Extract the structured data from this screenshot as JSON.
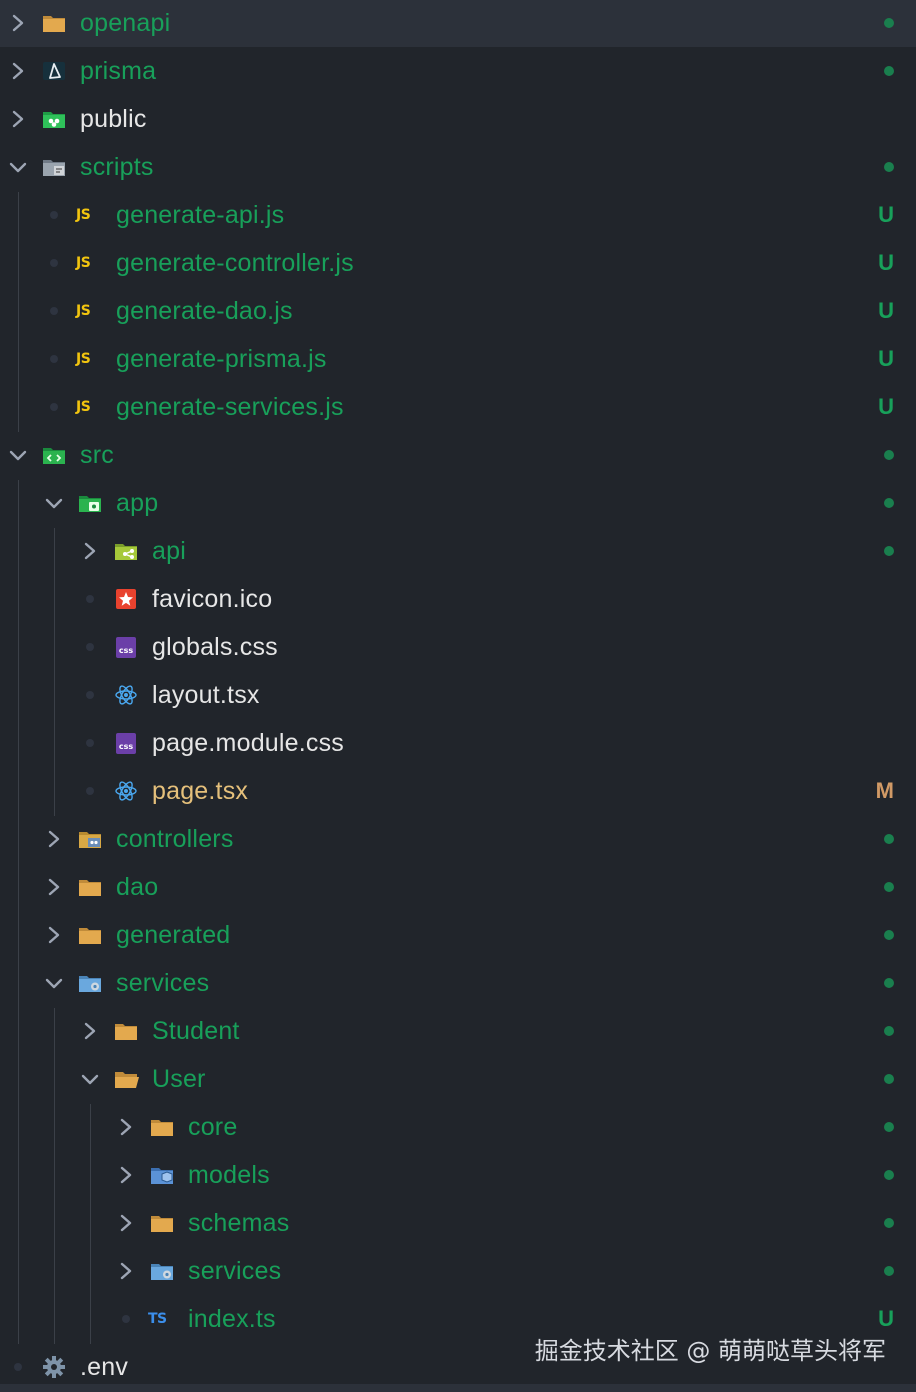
{
  "colors": {
    "green_label": "#2ea043",
    "folder_label": "#18a05a",
    "white_label": "#e6e6e6",
    "modified_label": "#e5c07b",
    "untracked_letter": "#18a05a",
    "modified_letter": "#d19a66"
  },
  "rows": [
    {
      "depth": 0,
      "kind": "folder",
      "expanded": false,
      "icon": "folder-icon",
      "label": "openapi",
      "color": "green",
      "status": "dot",
      "selected": true
    },
    {
      "depth": 0,
      "kind": "folder",
      "expanded": false,
      "icon": "prisma-icon",
      "label": "prisma",
      "color": "green",
      "status": "dot"
    },
    {
      "depth": 0,
      "kind": "folder",
      "expanded": false,
      "icon": "public-folder-icon",
      "label": "public",
      "color": "white",
      "status": ""
    },
    {
      "depth": 0,
      "kind": "folder",
      "expanded": true,
      "icon": "scripts-folder-icon",
      "label": "scripts",
      "color": "green",
      "status": "dot"
    },
    {
      "depth": 1,
      "kind": "file",
      "icon": "js-file-icon",
      "label": "generate-api.js",
      "color": "green",
      "status": "U"
    },
    {
      "depth": 1,
      "kind": "file",
      "icon": "js-file-icon",
      "label": "generate-controller.js",
      "color": "green",
      "status": "U"
    },
    {
      "depth": 1,
      "kind": "file",
      "icon": "js-file-icon",
      "label": "generate-dao.js",
      "color": "green",
      "status": "U"
    },
    {
      "depth": 1,
      "kind": "file",
      "icon": "js-file-icon",
      "label": "generate-prisma.js",
      "color": "green",
      "status": "U"
    },
    {
      "depth": 1,
      "kind": "file",
      "icon": "js-file-icon",
      "label": "generate-services.js",
      "color": "green",
      "status": "U"
    },
    {
      "depth": 0,
      "kind": "folder",
      "expanded": true,
      "icon": "src-folder-icon",
      "label": "src",
      "color": "green",
      "status": "dot"
    },
    {
      "depth": 1,
      "kind": "folder",
      "expanded": true,
      "icon": "app-folder-icon",
      "label": "app",
      "color": "green",
      "status": "dot"
    },
    {
      "depth": 2,
      "kind": "folder",
      "expanded": false,
      "icon": "api-folder-icon",
      "label": "api",
      "color": "green",
      "status": "dot"
    },
    {
      "depth": 2,
      "kind": "file",
      "icon": "favicon-file-icon",
      "label": "favicon.ico",
      "color": "white",
      "status": ""
    },
    {
      "depth": 2,
      "kind": "file",
      "icon": "css-file-icon",
      "label": "globals.css",
      "color": "white",
      "status": ""
    },
    {
      "depth": 2,
      "kind": "file",
      "icon": "react-file-icon",
      "label": "layout.tsx",
      "color": "white",
      "status": ""
    },
    {
      "depth": 2,
      "kind": "file",
      "icon": "css-file-icon",
      "label": "page.module.css",
      "color": "white",
      "status": ""
    },
    {
      "depth": 2,
      "kind": "file",
      "icon": "react-file-icon",
      "label": "page.tsx",
      "color": "modified",
      "status": "M"
    },
    {
      "depth": 1,
      "kind": "folder",
      "expanded": false,
      "icon": "controllers-folder-icon",
      "label": "controllers",
      "color": "green",
      "status": "dot"
    },
    {
      "depth": 1,
      "kind": "folder",
      "expanded": false,
      "icon": "folder-icon",
      "label": "dao",
      "color": "green",
      "status": "dot"
    },
    {
      "depth": 1,
      "kind": "folder",
      "expanded": false,
      "icon": "folder-icon",
      "label": "generated",
      "color": "green",
      "status": "dot"
    },
    {
      "depth": 1,
      "kind": "folder",
      "expanded": true,
      "icon": "services-folder-icon",
      "label": "services",
      "color": "green",
      "status": "dot"
    },
    {
      "depth": 2,
      "kind": "folder",
      "expanded": false,
      "icon": "folder-icon",
      "label": "Student",
      "color": "green",
      "status": "dot"
    },
    {
      "depth": 2,
      "kind": "folder",
      "expanded": true,
      "icon": "folder-open-icon",
      "label": "User",
      "color": "green",
      "status": "dot"
    },
    {
      "depth": 3,
      "kind": "folder",
      "expanded": false,
      "icon": "folder-icon",
      "label": "core",
      "color": "green",
      "status": "dot"
    },
    {
      "depth": 3,
      "kind": "folder",
      "expanded": false,
      "icon": "models-folder-icon",
      "label": "models",
      "color": "green",
      "status": "dot"
    },
    {
      "depth": 3,
      "kind": "folder",
      "expanded": false,
      "icon": "folder-icon",
      "label": "schemas",
      "color": "green",
      "status": "dot"
    },
    {
      "depth": 3,
      "kind": "folder",
      "expanded": false,
      "icon": "services-folder-icon",
      "label": "services",
      "color": "green",
      "status": "dot"
    },
    {
      "depth": 3,
      "kind": "file",
      "icon": "ts-file-icon",
      "label": "index.ts",
      "color": "green",
      "status": "U"
    },
    {
      "depth": 0,
      "kind": "file",
      "icon": "gear-icon",
      "label": ".env",
      "color": "white",
      "status": ""
    }
  ],
  "watermark": "掘金技术社区 @ 萌萌哒草头将军"
}
